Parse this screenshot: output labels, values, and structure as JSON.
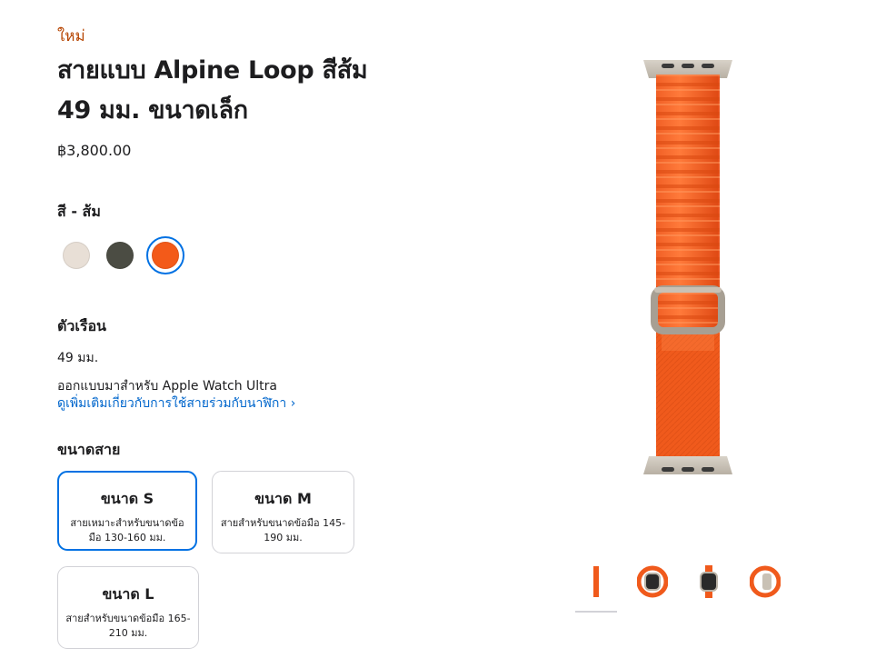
{
  "product": {
    "badge": "ใหม่",
    "title": "สายแบบ Alpine Loop สีส้ม 49 มม. ขนาดเล็ก",
    "price": "฿3,800.00"
  },
  "color": {
    "heading": "สี - ส้ม",
    "options": [
      {
        "name": "starlight",
        "hex": "#e8dfd6",
        "selected": false
      },
      {
        "name": "olive",
        "hex": "#4b4c43",
        "selected": false
      },
      {
        "name": "orange",
        "hex": "#f35a19",
        "selected": true
      }
    ]
  },
  "case": {
    "heading": "ตัวเรือน",
    "size": "49 มม.",
    "designed_for": "ออกแบบมาสำหรับ Apple Watch Ultra",
    "compat_link": "ดูเพิ่มเติมเกี่ยวกับการใช้สายร่วมกับนาฬิกา ›"
  },
  "band_size": {
    "heading": "ขนาดสาย",
    "options": [
      {
        "label": "ขนาด S",
        "desc": "สายเหมาะสำหรับขนาดข้อมือ 130-160 มม.",
        "selected": true
      },
      {
        "label": "ขนาด M",
        "desc": "สายสำหรับขนาดข้อมือ 145-190 มม.",
        "selected": false
      },
      {
        "label": "ขนาด L",
        "desc": "สายสำหรับขนาดข้อมือ 165-210 มม.",
        "selected": false
      }
    ]
  },
  "gallery": {
    "thumbnails": [
      "band-front",
      "watch-front-left",
      "watch-front",
      "watch-side"
    ],
    "selected_index": 0
  },
  "colors": {
    "accent": "#0071e3",
    "link": "#0066cc",
    "new_badge": "#b64400",
    "band_orange": "#f35a19"
  }
}
